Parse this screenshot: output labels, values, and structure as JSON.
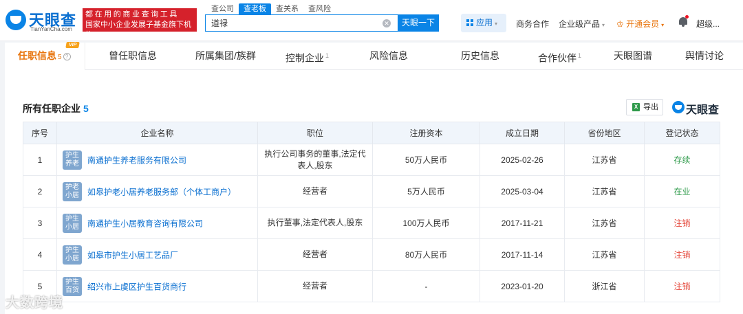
{
  "header": {
    "logo_text": "天眼查",
    "logo_sub": "TianYanCha.com",
    "promo_line1": "都在用的商业查询工具",
    "promo_line2": "国家中小企业发展子基金旗下机构",
    "search_tabs": [
      "查公司",
      "查老板",
      "查关系",
      "查风险"
    ],
    "search_value": "道禄",
    "clear_glyph": "✕",
    "search_button": "天眼一下",
    "app_button": "应用",
    "nav": {
      "business": "商务合作",
      "enterprise": "企业级产品",
      "vip": "开通会员",
      "user": "超级..."
    },
    "caret": "▾",
    "crown": "♔"
  },
  "tabs": [
    {
      "label": "任职信息",
      "count": "5"
    },
    {
      "label": "曾任职信息",
      "count": ""
    },
    {
      "label": "所属集团/族群",
      "count": ""
    },
    {
      "label": "控制企业",
      "count": "1"
    },
    {
      "label": "风险信息",
      "count": ""
    },
    {
      "label": "历史信息",
      "count": ""
    },
    {
      "label": "合作伙伴",
      "count": "1"
    },
    {
      "label": "天眼图谱",
      "count": ""
    },
    {
      "label": "舆情讨论",
      "count": ""
    }
  ],
  "vip_tag": "VIP",
  "help_glyph": "?",
  "section": {
    "title": "所有任职企业",
    "count": "5",
    "export_label": "导出",
    "excel_glyph": "X",
    "brand": "天眼查"
  },
  "table": {
    "headers": [
      "序号",
      "企业名称",
      "职位",
      "注册资本",
      "成立日期",
      "省份地区",
      "登记状态"
    ],
    "rows": [
      {
        "no": "1",
        "avatar_l1": "护生",
        "avatar_l2": "养老",
        "name": "南通护生养老服务有限公司",
        "position_l1": "执行公司事务的董事,法定代",
        "position_l2": "表人,股东",
        "capital": "50万人民币",
        "date": "2025-02-26",
        "region": "江苏省",
        "status": "存续",
        "status_color": "#2e9a4a"
      },
      {
        "no": "2",
        "avatar_l1": "护老",
        "avatar_l2": "小居",
        "name": "如皋护老小居养老服务部（个体工商户）",
        "position_l1": "经营者",
        "position_l2": "",
        "capital": "5万人民币",
        "date": "2025-03-04",
        "region": "江苏省",
        "status": "在业",
        "status_color": "#2e9a4a"
      },
      {
        "no": "3",
        "avatar_l1": "护生",
        "avatar_l2": "小居",
        "name": "南通护生小居教育咨询有限公司",
        "position_l1": "执行董事,法定代表人,股东",
        "position_l2": "",
        "capital": "100万人民币",
        "date": "2017-11-21",
        "region": "江苏省",
        "status": "注销",
        "status_color": "#e54b3f"
      },
      {
        "no": "4",
        "avatar_l1": "护生",
        "avatar_l2": "小居",
        "name": "如皋市护生小居工艺品厂",
        "position_l1": "经营者",
        "position_l2": "",
        "capital": "80万人民币",
        "date": "2017-11-14",
        "region": "江苏省",
        "status": "注销",
        "status_color": "#e54b3f"
      },
      {
        "no": "5",
        "avatar_l1": "护生",
        "avatar_l2": "百货",
        "name": "绍兴市上虞区护生百货商行",
        "position_l1": "经营者",
        "position_l2": "",
        "capital": "-",
        "date": "2023-01-20",
        "region": "浙江省",
        "status": "注销",
        "status_color": "#e54b3f"
      }
    ]
  },
  "watermark": "大数跨境"
}
